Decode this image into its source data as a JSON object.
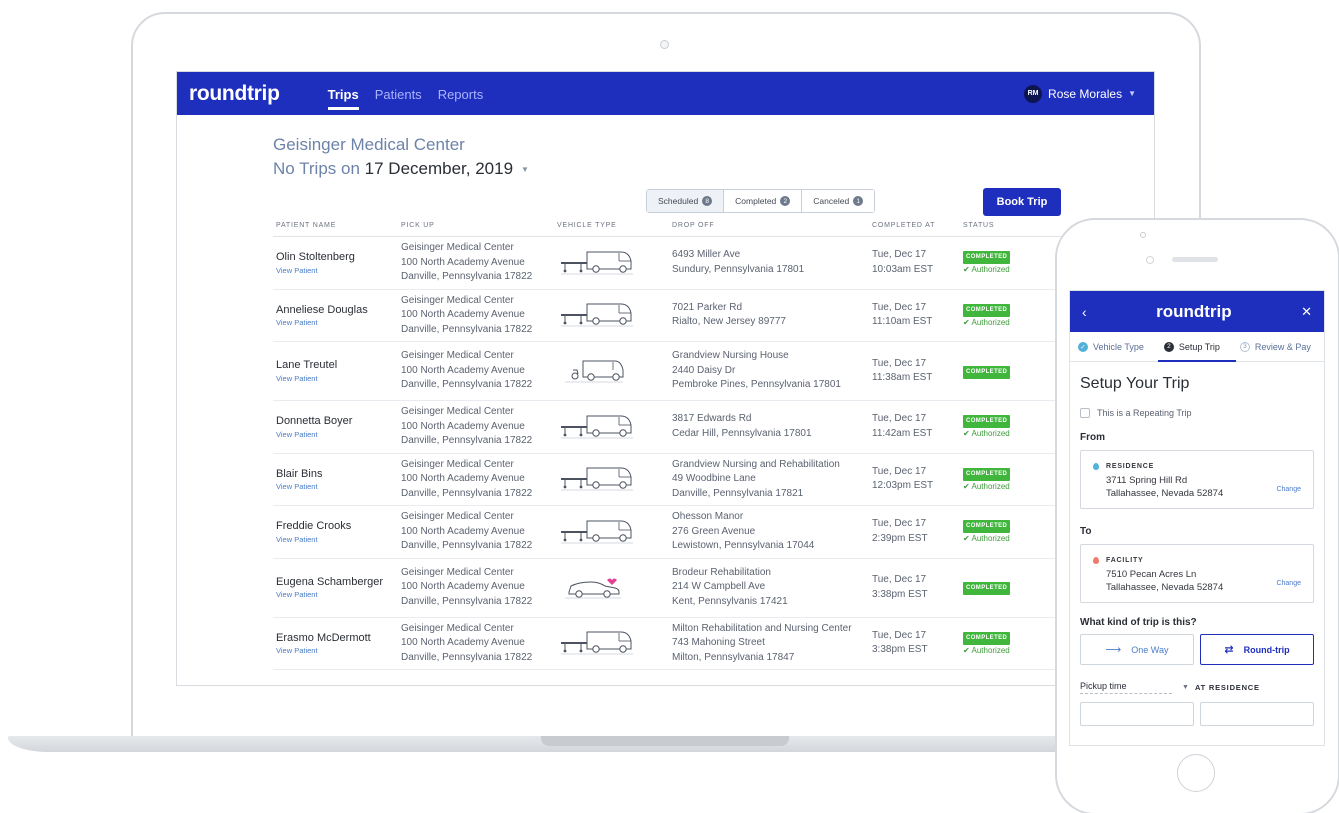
{
  "app": {
    "brand": "roundtrip",
    "nav": [
      "Trips",
      "Patients",
      "Reports"
    ],
    "active_nav": "Trips",
    "user": {
      "initials": "RM",
      "name": "Rose Morales"
    }
  },
  "header": {
    "facility": "Geisinger Medical Center",
    "date_prefix": "No Trips on ",
    "date": "17 December, 2019"
  },
  "filters": [
    {
      "label": "Scheduled",
      "count": "8"
    },
    {
      "label": "Completed",
      "count": "2"
    },
    {
      "label": "Canceled",
      "count": "1"
    }
  ],
  "book_button": "Book Trip",
  "table": {
    "columns": [
      "PATIENT NAME",
      "PICK UP",
      "VEHICLE TYPE",
      "DROP OFF",
      "COMPLETED AT",
      "STATUS"
    ],
    "view_link": "View Patient",
    "status_label": "COMPLETED",
    "auth_label": "Authorized",
    "rows": [
      {
        "name": "Olin Stoltenberg",
        "pickup": [
          "Geisinger Medical Center",
          "100 North Academy Avenue",
          "Danville, Pennsylvania 17822"
        ],
        "vehicle": "stretcher-van",
        "dropoff": [
          "6493 Miller Ave",
          "Sundury, Pennsylvania 17801"
        ],
        "date": "Tue, Dec 17",
        "time": "10:03am EST",
        "authorized": true
      },
      {
        "name": "Anneliese Douglas",
        "pickup": [
          "Geisinger Medical Center",
          "100 North Academy Avenue",
          "Danville, Pennsylvania 17822"
        ],
        "vehicle": "stretcher-van",
        "dropoff": [
          "7021 Parker Rd",
          "Rialto, New Jersey 89777"
        ],
        "date": "Tue, Dec 17",
        "time": "11:10am EST",
        "authorized": true
      },
      {
        "name": "Lane Treutel",
        "pickup": [
          "Geisinger Medical Center",
          "100 North Academy Avenue",
          "Danville, Pennsylvania 17822"
        ],
        "vehicle": "wheelchair-van",
        "dropoff": [
          "Grandview Nursing House",
          "2440 Daisy Dr",
          "Pembroke Pines, Pennsylvania 17801"
        ],
        "date": "Tue, Dec 17",
        "time": "11:38am EST",
        "authorized": false
      },
      {
        "name": "Donnetta Boyer",
        "pickup": [
          "Geisinger Medical Center",
          "100 North Academy Avenue",
          "Danville, Pennsylvania 17822"
        ],
        "vehicle": "stretcher-van",
        "dropoff": [
          "3817 Edwards Rd",
          "Cedar Hill, Pennsylvania 17801"
        ],
        "date": "Tue, Dec 17",
        "time": "11:42am EST",
        "authorized": true
      },
      {
        "name": "Blair Bins",
        "pickup": [
          "Geisinger Medical Center",
          "100 North Academy Avenue",
          "Danville, Pennsylvania 17822"
        ],
        "vehicle": "stretcher-van",
        "dropoff": [
          "Grandview Nursing and Rehabilitation",
          "49 Woodbine Lane",
          "Danville, Pennsylvania 17821"
        ],
        "date": "Tue, Dec 17",
        "time": "12:03pm EST",
        "authorized": true
      },
      {
        "name": "Freddie Crooks",
        "pickup": [
          "Geisinger Medical Center",
          "100 North Academy Avenue",
          "Danville, Pennsylvania 17822"
        ],
        "vehicle": "stretcher-van",
        "dropoff": [
          "Ohesson Manor",
          "276 Green Avenue",
          "Lewistown, Pennsylvania 17044"
        ],
        "date": "Tue, Dec 17",
        "time": "2:39pm EST",
        "authorized": true
      },
      {
        "name": "Eugena Schamberger",
        "pickup": [
          "Geisinger Medical Center",
          "100 North Academy Avenue",
          "Danville, Pennsylvania 17822"
        ],
        "vehicle": "sedan",
        "dropoff": [
          "Brodeur Rehabilitation",
          "214 W Campbell Ave",
          "Kent, Pennsylvanis 17421"
        ],
        "date": "Tue, Dec 17",
        "time": "3:38pm EST",
        "authorized": false
      },
      {
        "name": "Erasmo McDermott",
        "pickup": [
          "Geisinger Medical Center",
          "100 North Academy Avenue",
          "Danville, Pennsylvania 17822"
        ],
        "vehicle": "stretcher-van",
        "dropoff": [
          "Milton Rehabilitation and Nursing Center",
          "743 Mahoning Street",
          "Milton, Pennsylvania 17847"
        ],
        "date": "Tue, Dec 17",
        "time": "3:38pm EST",
        "authorized": true
      }
    ]
  },
  "mobile": {
    "brand": "roundtrip",
    "back_icon": "chevron-left-icon",
    "close_icon": "close-icon",
    "steps": [
      {
        "num": "✓",
        "label": "Vehicle Type",
        "state": "done"
      },
      {
        "num": "2",
        "label": "Setup Trip",
        "state": "current"
      },
      {
        "num": "3",
        "label": "Review & Pay",
        "state": "todo"
      }
    ],
    "title": "Setup Your Trip",
    "repeat_label": "This is a Repeating Trip",
    "from_label": "From",
    "from": {
      "type": "RESIDENCE",
      "line1": "3711 Spring Hill Rd",
      "line2": "Tallahassee, Nevada 52874",
      "pin_color": "#4fb3d9"
    },
    "to_label": "To",
    "to": {
      "type": "FACILITY",
      "line1": "7510 Pecan Acres Ln",
      "line2": "Tallahassee, Nevada 52874",
      "pin_color": "#f07a6e"
    },
    "change_label": "Change",
    "trip_kind_label": "What kind of trip is this?",
    "one_way": "One Way",
    "round_trip": "Round-trip",
    "pickup_label": "Pickup time",
    "at_residence": "AT RESIDENCE"
  },
  "colors": {
    "primary": "#1f2fbd",
    "success": "#40b63c",
    "link": "#4a7cc9"
  }
}
